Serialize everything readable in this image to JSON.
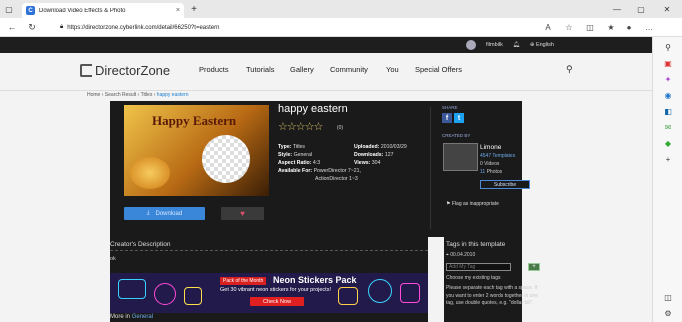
{
  "browser": {
    "tab_title": "Download Video Effects & Photo",
    "tab_close": "×",
    "new_tab": "+",
    "url": "https://directorzone.cyberlink.com/detail/66250?t=eastern",
    "window_controls": {
      "minimize": "—",
      "maximize": "▢",
      "close": "✕"
    }
  },
  "topstrip": {
    "username": "filmbilk",
    "language": "English"
  },
  "header": {
    "logo": "DirectorZone",
    "nav": [
      "Products",
      "Tutorials",
      "Gallery",
      "Community",
      "You",
      "Special Offers"
    ]
  },
  "breadcrumb": {
    "home": "Home",
    "sep": "›",
    "search_result": "Search Result",
    "titles": "Titles",
    "current": "happy eastern"
  },
  "template": {
    "title": "happy eastern",
    "thumbnail_text": "Happy Eastern",
    "rating_stars": "☆☆☆☆☆",
    "rating_count": "(0)",
    "type_label": "Type:",
    "type_value": "Titles",
    "style_label": "Style:",
    "style_value": "General",
    "aspect_label": "Aspect Ratio:",
    "aspect_value": "4:3",
    "available_label": "Available For:",
    "available_value1": "PowerDirector 7~21,",
    "available_value2": "ActionDirector 1~3",
    "uploaded_label": "Uploaded:",
    "uploaded_value": "2010/03/29",
    "downloads_label": "Downloads:",
    "downloads_value": "127",
    "views_label": "Views:",
    "views_value": "304",
    "download_label": "Download",
    "share_label": "SHARE",
    "created_by_label": "CREATED BY",
    "creator_name": "Limone",
    "creator_templates": "4547 Templates",
    "creator_videos": "0 Videos",
    "creator_photos_count": "11",
    "creator_photos_word": "Photos",
    "subscribe_label": "Subscribe",
    "flag_label": "Flag as inappropriate"
  },
  "description": {
    "title": "Creator's Description",
    "text": "ok"
  },
  "banner": {
    "pack_label": "Pack of the Month",
    "title": "Neon Stickers Pack",
    "subtitle": "Get 30 vibrant neon stickers for your projects!",
    "cta": "Check Now"
  },
  "more": {
    "label": "More in",
    "category": "General"
  },
  "tags": {
    "title": "Tags in this template",
    "tag_date": "00.04.2010",
    "input_placeholder": "Add My Tag",
    "add_button": "+",
    "choose_label": "Choose my existing tags",
    "hint": "Please separate each tag with a space. If you want to enter 2 words together in one tag, use double quotes, e.g. \"dollar bill\"."
  }
}
